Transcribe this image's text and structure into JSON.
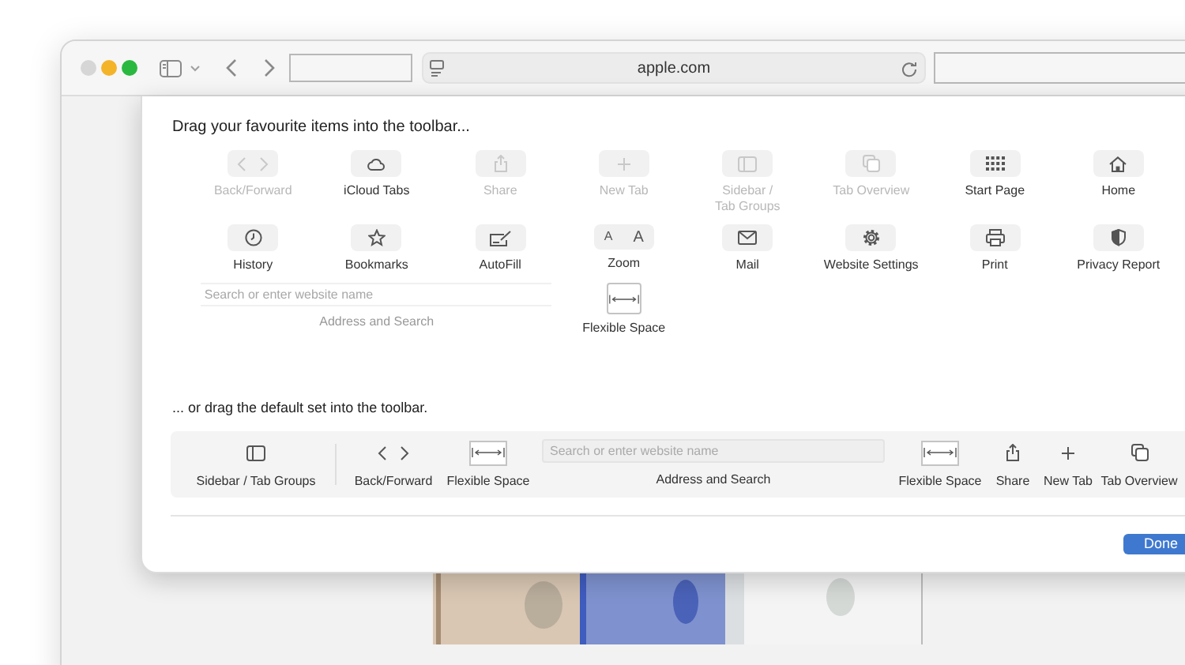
{
  "window": {
    "address": "apple.com"
  },
  "customize_sheet": {
    "title": "Drag your favourite items into the toolbar...",
    "palette": [
      {
        "kind": "button",
        "label": "Back/Forward",
        "disabled": true
      },
      {
        "kind": "button",
        "label": "iCloud Tabs",
        "disabled": false
      },
      {
        "kind": "button",
        "label": "Share",
        "disabled": true
      },
      {
        "kind": "button",
        "label": "New Tab",
        "disabled": true
      },
      {
        "kind": "button",
        "label": "Sidebar /\nTab Groups",
        "disabled": true
      },
      {
        "kind": "button",
        "label": "Tab Overview",
        "disabled": true
      },
      {
        "kind": "button",
        "label": "Start Page",
        "disabled": false
      },
      {
        "kind": "button",
        "label": "Home",
        "disabled": false
      },
      {
        "kind": "button",
        "label": "History",
        "disabled": false
      },
      {
        "kind": "button",
        "label": "Bookmarks",
        "disabled": false
      },
      {
        "kind": "button",
        "label": "AutoFill",
        "disabled": false
      },
      {
        "kind": "zoom",
        "glyphs": [
          "A",
          "A"
        ],
        "label": "Zoom",
        "disabled": false
      },
      {
        "kind": "button",
        "label": "Mail",
        "disabled": false
      },
      {
        "kind": "button",
        "label": "Website Settings",
        "disabled": false
      },
      {
        "kind": "button",
        "label": "Print",
        "disabled": false
      },
      {
        "kind": "button",
        "label": "Privacy Report",
        "disabled": false
      },
      {
        "kind": "address",
        "placeholder": "Search or enter website name",
        "label": "Address and Search",
        "disabled": true
      },
      {
        "kind": "flexible_space",
        "label": "Flexible Space",
        "disabled": false
      }
    ],
    "default_set_title": "... or drag the default set into the toolbar.",
    "default_set": [
      {
        "kind": "button",
        "label": "Sidebar / Tab Groups"
      },
      {
        "kind": "separator"
      },
      {
        "kind": "back_forward",
        "label": "Back/Forward"
      },
      {
        "kind": "flexible_space",
        "label": "Flexible Space"
      },
      {
        "kind": "address",
        "placeholder": "Search or enter website name",
        "label": "Address and Search"
      },
      {
        "kind": "flexible_space",
        "label": "Flexible Space"
      },
      {
        "kind": "button",
        "label": "Share"
      },
      {
        "kind": "button",
        "label": "New Tab"
      },
      {
        "kind": "button",
        "label": "Tab Overview"
      }
    ],
    "done_button": "Done"
  }
}
